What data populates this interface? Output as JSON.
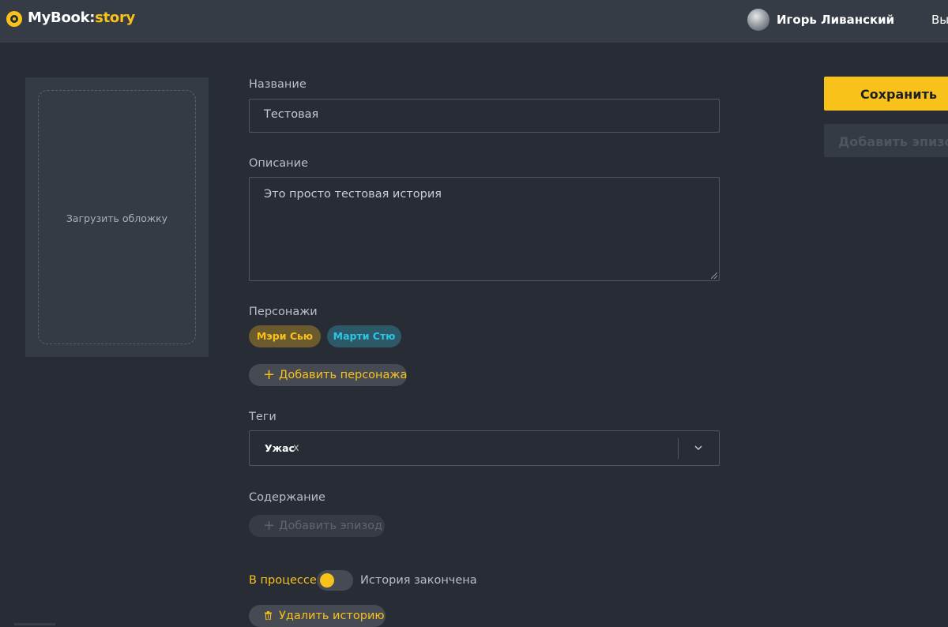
{
  "header": {
    "brand_main": "MyBook:",
    "brand_accent": "story",
    "user_name": "Игорь Ливанский",
    "logout_label": "Выйти"
  },
  "cover": {
    "upload_label": "Загрузить обложку"
  },
  "form": {
    "title_label": "Название",
    "title_value": "Тестовая",
    "description_label": "Описание",
    "description_value": "Это просто тестовая история",
    "characters_label": "Персонажи",
    "characters": [
      {
        "name": "Мэри Сью",
        "color": "#f8c21b"
      },
      {
        "name": "Марти Стю",
        "color": "#2cc6e6"
      }
    ],
    "add_character_label": "Добавить персонажа",
    "tags_label": "Теги",
    "tags": [
      "Ужас"
    ],
    "tag_remove_symbol": "x",
    "content_label": "Содержание",
    "add_episode_inline_label": "Добавить эпизод",
    "status_in_progress": "В процессе",
    "status_finished": "История закончена",
    "status_toggle_finished": false,
    "delete_story_label": "Удалить историю"
  },
  "actions": {
    "save_label": "Сохранить",
    "add_episode_label": "Добавить эпизод"
  },
  "colors": {
    "accent": "#f8c21b",
    "background": "#282c34",
    "header": "#363c46"
  }
}
